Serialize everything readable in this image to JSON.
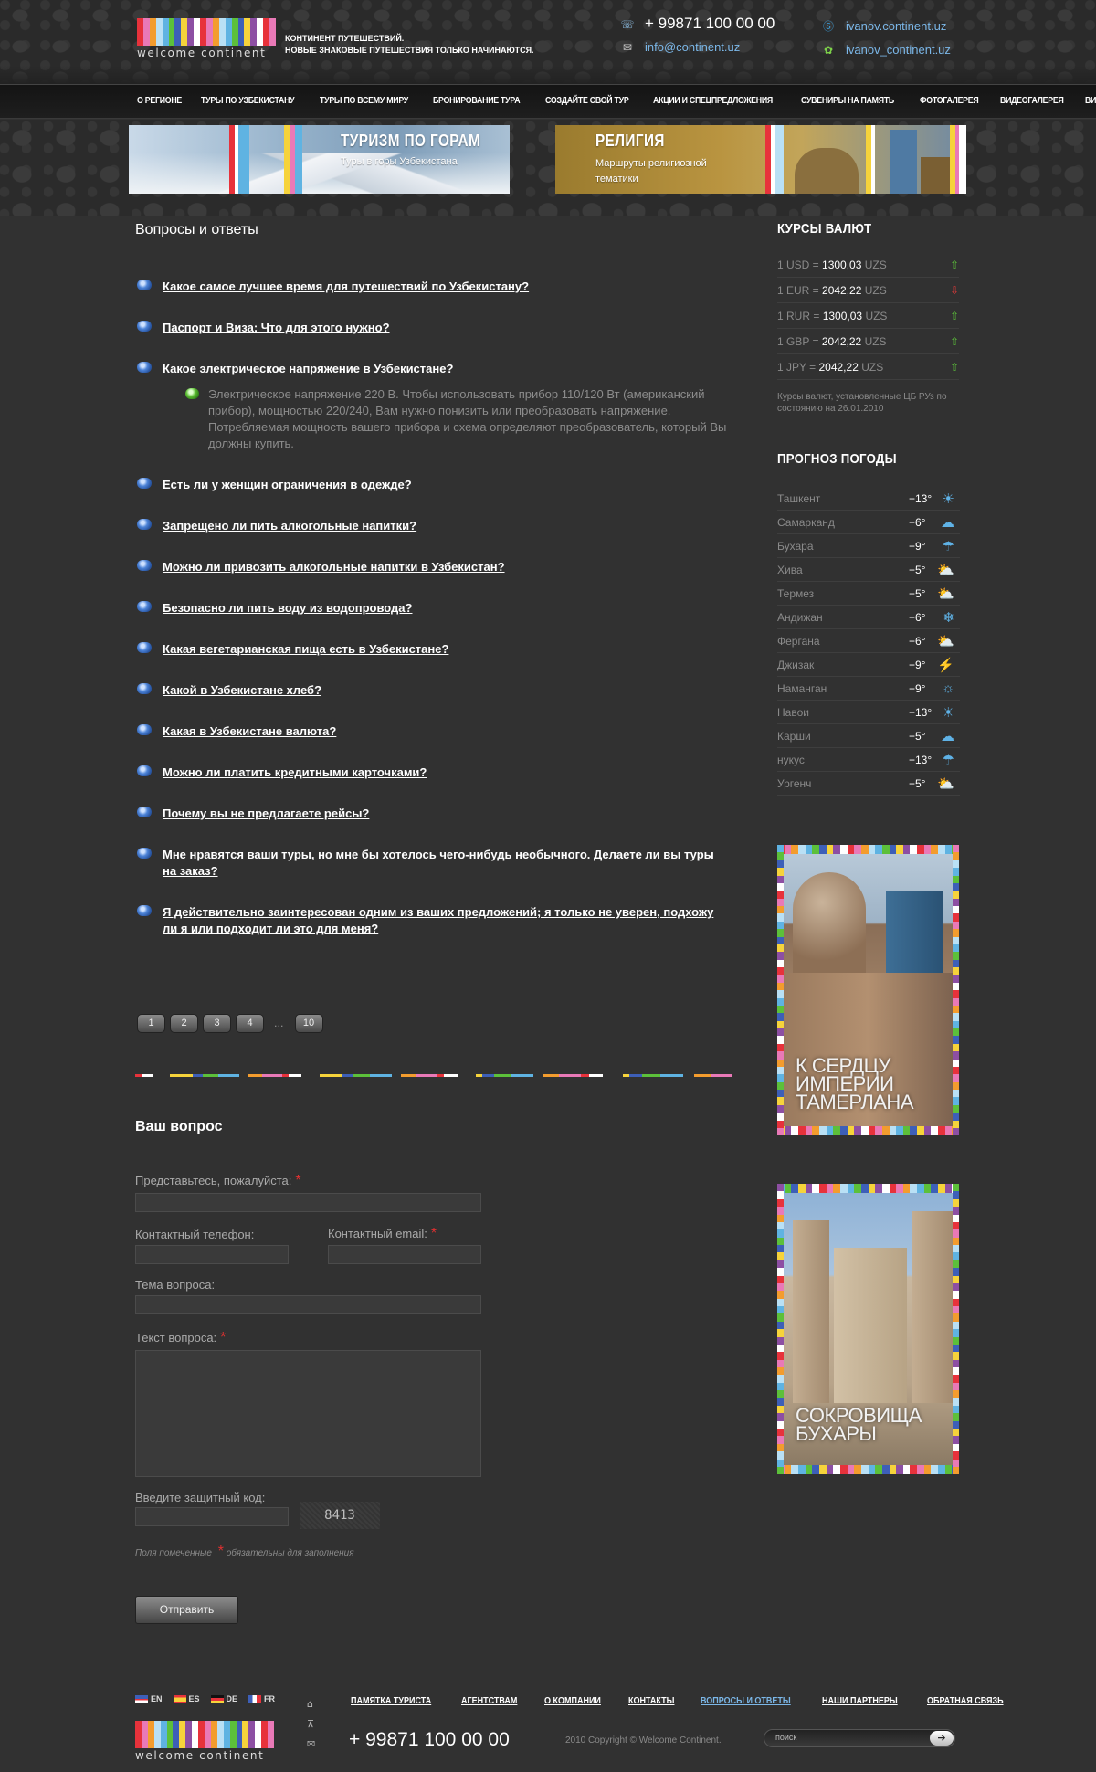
{
  "colors": {
    "accent_link": "#7bb7e8",
    "required": "#e03030",
    "up_arrow": "#5cc03a",
    "down_arrow": "#e03a3a",
    "weather_icon": "#5fb2e6",
    "stripe_palette": [
      "#e7323b",
      "#f6d33b",
      "#5fb3e2",
      "#e979b7",
      "#8d4fa3",
      "#5cc03a",
      "#f39c2e",
      "#ffffff",
      "#3d5fb8",
      "#b9e0f5"
    ]
  },
  "header": {
    "logo_text": "welcome continent",
    "tagline_line1": "КОНТИНЕНТ ПУТЕШЕСТВИЙ.",
    "tagline_line2": "НОВЫЕ ЗНАКОВЫЕ ПУТЕШЕСТВИЯ ТОЛЬКО НАЧИНАЮТСЯ.",
    "phone": "+ 99871 100 00 00",
    "email": "info@continent.uz",
    "skype": "ivanov.continent.uz",
    "icq": "ivanov_continent.uz",
    "icons": {
      "phone": "phone-icon",
      "mail": "mail-icon",
      "skype": "skype-icon",
      "icq": "icq-flower-icon"
    }
  },
  "nav": {
    "items": [
      "О РЕГИОНЕ",
      "ТУРЫ ПО УЗБЕКИСТАНУ",
      "ТУРЫ ПО ВСЕМУ МИРУ",
      "БРОНИРОВАНИЕ ТУРА",
      "СОЗДАЙТЕ СВОЙ ТУР",
      "АКЦИИ И СПЕЦПРЕДЛОЖЕНИЯ",
      "СУВЕНИРЫ НА ПАМЯТЬ",
      "ФОТОГАЛЕРЕЯ",
      "ВИДЕОГАЛЕРЕЯ",
      "ВИЗА"
    ]
  },
  "banners": [
    {
      "title": "ТУРИЗМ ПО ГОРАМ",
      "subtitle": "Туры в горы Узбекистана"
    },
    {
      "title": "РЕЛИГИЯ",
      "subtitle": "Маршруты религиозной тематики"
    }
  ],
  "main": {
    "title": "Вопросы и ответы",
    "faq": [
      {
        "q": "Какое самое лучшее время для путешествий по Узбекистану?"
      },
      {
        "q": "Паспорт и Виза: Что для этого нужно?"
      },
      {
        "q": "Какое электрическое напряжение в Узбекистане?",
        "a": "Электрическое напряжение 220 В. Чтобы использовать прибор 110/120 Вт (американский прибор), мощностью 220/240, Вам нужно понизить или преобразовать напряжение. Потребляемая мощность вашего прибора и схема определяют преобразователь, который Вы должны купить."
      },
      {
        "q": "Есть ли у женщин ограничения в одежде?"
      },
      {
        "q": "Запрещено ли пить алкогольные напитки?"
      },
      {
        "q": "Можно ли привозить алкогольные напитки в Узбекистан?"
      },
      {
        "q": "Безопасно ли пить воду из водопровода?"
      },
      {
        "q": "Какая вегетарианская пища есть в Узбекистане?"
      },
      {
        "q": "Какой в Узбекистане хлеб?"
      },
      {
        "q": "Какая в Узбекистане валюта?"
      },
      {
        "q": "Можно ли платить кредитными карточками?"
      },
      {
        "q": "Почему вы не предлагаете рейсы?"
      },
      {
        "q": "Мне нравятся ваши туры, но мне бы хотелось чего-нибудь необычного. Делаете ли вы туры на заказ?"
      },
      {
        "q": "Я действительно заинтересован одним из ваших предложений; я только не уверен, подхожу ли я или подходит ли это для меня?"
      }
    ],
    "pager": {
      "pages": [
        "1",
        "2",
        "3",
        "4"
      ],
      "ellipsis": "...",
      "last": "10"
    }
  },
  "form": {
    "title": "Ваш вопрос",
    "name_label": "Представьтесь, пожалуйста:",
    "phone_label": "Контактный телефон:",
    "email_label": "Контактный email:",
    "subject_label": "Тема вопроса:",
    "text_label": "Текст вопроса:",
    "captcha_label": "Введите защитный код:",
    "captcha_code": "8413",
    "required_mark": "*",
    "note_before": "Поля помеченные",
    "note_after": "обязательны для заполнения",
    "submit": "Отправить"
  },
  "sidebar": {
    "rates_title": "КУРСЫ ВАЛЮТ",
    "rates": [
      {
        "label": "1 USD =",
        "value": "1300,03",
        "unit": "UZS",
        "trend": "up"
      },
      {
        "label": "1 EUR =",
        "value": "2042,22",
        "unit": "UZS",
        "trend": "down"
      },
      {
        "label": "1 RUR =",
        "value": "1300,03",
        "unit": "UZS",
        "trend": "up"
      },
      {
        "label": "1 GBP =",
        "value": "2042,22",
        "unit": "UZS",
        "trend": "up"
      },
      {
        "label": "1 JPY =",
        "value": "2042,22",
        "unit": "UZS",
        "trend": "up"
      }
    ],
    "rates_note": "Курсы валют, установленные ЦБ РУз по состоянию на 26.01.2010",
    "weather_title": "ПРОГНОЗ ПОГОДЫ",
    "weather": [
      {
        "city": "Ташкент",
        "temp": "+13°",
        "icon": "sun-icon"
      },
      {
        "city": "Самарканд",
        "temp": "+6°",
        "icon": "cloud-icon"
      },
      {
        "city": "Бухара",
        "temp": "+9°",
        "icon": "rain-cloud-icon"
      },
      {
        "city": "Хива",
        "temp": "+5°",
        "icon": "sun-cloud-icon"
      },
      {
        "city": "Термез",
        "temp": "+5°",
        "icon": "sun-cloud-icon"
      },
      {
        "city": "Андижан",
        "temp": "+6°",
        "icon": "snow-cloud-icon"
      },
      {
        "city": "Фергана",
        "temp": "+6°",
        "icon": "sun-cloud-icon"
      },
      {
        "city": "Джизак",
        "temp": "+9°",
        "icon": "storm-cloud-icon"
      },
      {
        "city": "Наманган",
        "temp": "+9°",
        "icon": "sun-rain-icon"
      },
      {
        "city": "Навои",
        "temp": "+13°",
        "icon": "sun-icon"
      },
      {
        "city": "Карши",
        "temp": "+5°",
        "icon": "cloud-icon"
      },
      {
        "city": "нукус",
        "temp": "+13°",
        "icon": "rain-cloud-icon"
      },
      {
        "city": "Ургенч",
        "temp": "+5°",
        "icon": "sun-cloud-icon"
      }
    ],
    "promos": [
      {
        "line1": "К СЕРДЦУ",
        "line2": "ИМПЕРИИ",
        "line3": "ТАМЕРЛАНА"
      },
      {
        "line1": "СОКРОВИЩА",
        "line2": "БУХАРЫ"
      }
    ]
  },
  "footer": {
    "langs": [
      "EN",
      "ES",
      "DE",
      "FR"
    ],
    "logo_text": "welcome continent",
    "phone": "+ 99871 100 00 00",
    "copyright": "2010 Copyright © Welcome Continent.",
    "links": [
      "ПАМЯТКА ТУРИСТА",
      "АГЕНТСТВАМ",
      "О КОМПАНИИ",
      "КОНТАКТЫ",
      "ВОПРОСЫ И ОТВЕТЫ",
      "НАШИ ПАРТНЕРЫ",
      "ОБРАТНАЯ СВЯЗЬ"
    ],
    "active_link": 4,
    "search_placeholder": "поиск",
    "icons": [
      "home-icon",
      "sitemap-icon",
      "mail-icon"
    ]
  }
}
